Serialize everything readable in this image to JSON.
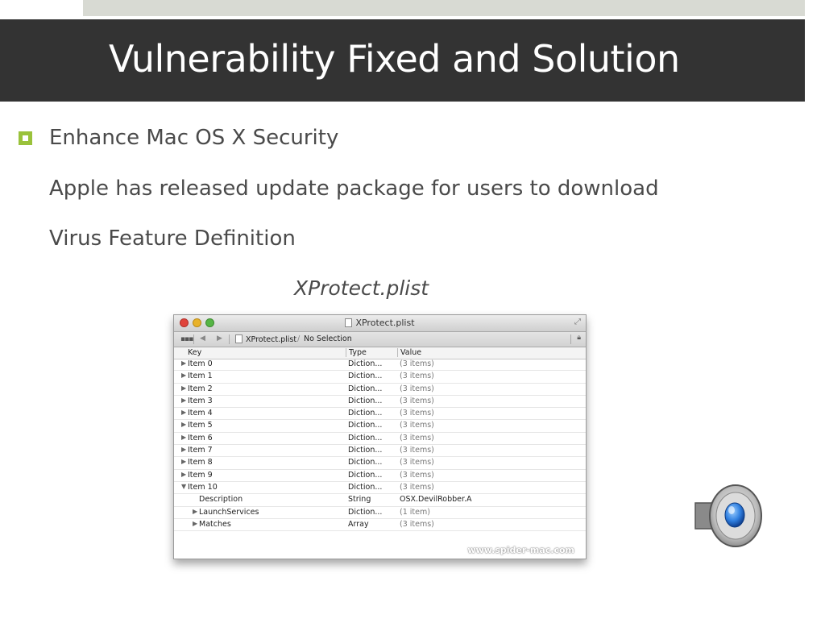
{
  "slide": {
    "title": "Vulnerability Fixed and Solution",
    "bullet": "Enhance Mac OS X Security",
    "line2": "Apple has released update package for users to download",
    "line3": "Virus Feature Definition",
    "caption": "XProtect.plist"
  },
  "window": {
    "title": "XProtect.plist",
    "toolbar": {
      "file": "XProtect.plist",
      "selection": "No Selection"
    },
    "columns": {
      "key": "Key",
      "type": "Type",
      "value": "Value"
    },
    "rows": [
      {
        "key": "Item 0",
        "type": "Diction...",
        "value": "(3 items)"
      },
      {
        "key": "Item 1",
        "type": "Diction...",
        "value": "(3 items)"
      },
      {
        "key": "Item 2",
        "type": "Diction...",
        "value": "(3 items)"
      },
      {
        "key": "Item 3",
        "type": "Diction...",
        "value": "(3 items)"
      },
      {
        "key": "Item 4",
        "type": "Diction...",
        "value": "(3 items)"
      },
      {
        "key": "Item 5",
        "type": "Diction...",
        "value": "(3 items)"
      },
      {
        "key": "Item 6",
        "type": "Diction...",
        "value": "(3 items)"
      },
      {
        "key": "Item 7",
        "type": "Diction...",
        "value": "(3 items)"
      },
      {
        "key": "Item 8",
        "type": "Diction...",
        "value": "(3 items)"
      },
      {
        "key": "Item 9",
        "type": "Diction...",
        "value": "(3 items)"
      },
      {
        "key": "Item 10",
        "type": "Diction...",
        "value": "(3 items)"
      },
      {
        "key": "Description",
        "type": "String",
        "value": "OSX.DevilRobber.A"
      },
      {
        "key": "LaunchServices",
        "type": "Diction...",
        "value": "(1 item)"
      },
      {
        "key": "Matches",
        "type": "Array",
        "value": "(3 items)"
      }
    ],
    "watermark": "www.spider-mac.com"
  },
  "colors": {
    "title_bar": "#333333",
    "accent_bullet": "#9ac23b",
    "strip": "#d8dad3"
  },
  "icons": {
    "bullet": "square-bullet-icon",
    "audio": "speaker-icon"
  }
}
